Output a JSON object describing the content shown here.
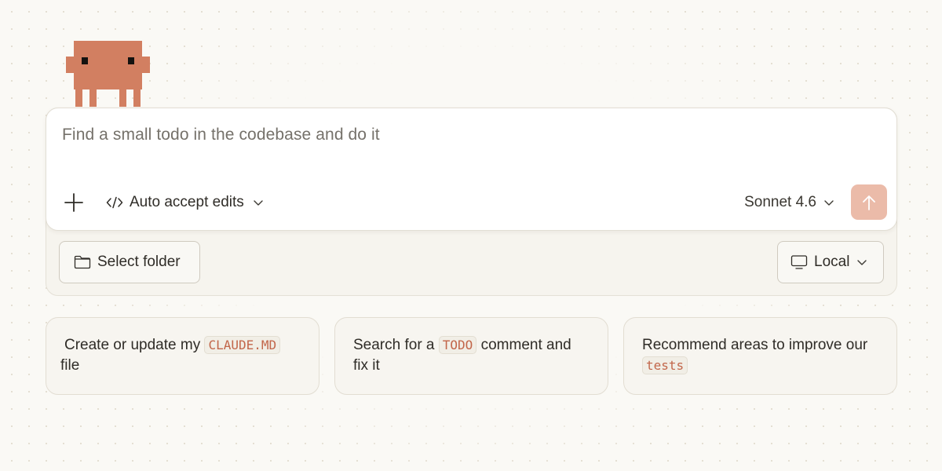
{
  "composer": {
    "prompt": "Find a small todo in the codebase and do it",
    "mode_label": "Auto accept edits",
    "model_label": "Sonnet 4.6"
  },
  "folder_button": {
    "label": "Select folder"
  },
  "environment_button": {
    "label": "Local"
  },
  "suggestions": [
    {
      "before": "Create or update my ",
      "code": "CLAUDE.MD",
      "after": " file"
    },
    {
      "before": "Search for a ",
      "code": "TODO",
      "after": " comment and fix it"
    },
    {
      "before": "Recommend areas to improve our ",
      "code": "tests",
      "after": ""
    }
  ],
  "colors": {
    "mascot": "#d27f61",
    "send_button": "#ebbba9",
    "code_text": "#c2664a",
    "background": "#faf9f5"
  },
  "icons": {
    "add": "plus-icon",
    "mode": "code-icon",
    "send": "arrow-up-icon",
    "folder": "folder-icon",
    "environment": "monitor-icon"
  }
}
